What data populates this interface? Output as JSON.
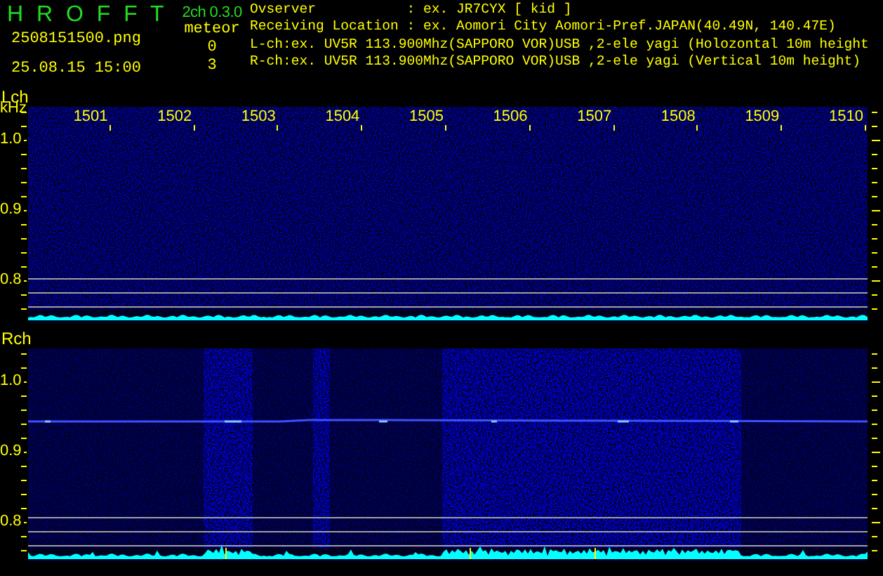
{
  "header": {
    "app_name": "H R O F F T",
    "version": "2ch 0.3.0",
    "filename": "2508151500.png",
    "timestamp": "25.08.15 15:00",
    "detection_label": "meteor",
    "counts": [
      "0",
      "3"
    ],
    "info_lines": [
      "Ovserver           : ex. JR7CYX [ kid ]",
      "Receiving Location : ex. Aomori City Aomori-Pref.JAPAN(40.49N, 140.47E)",
      "L-ch:ex. UV5R 113.900Mhz(SAPPORO VOR)USB ,2-ele yagi (Holozontal 10m height",
      "R-ch:ex. UV5R 113.900Mhz(SAPPORO VOR)USB ,2-ele yagi (Vertical 10m height)"
    ]
  },
  "channels": [
    {
      "label": "Lch",
      "unit": "kHz",
      "time_ticks": [
        "1501",
        "1502",
        "1503",
        "1504",
        "1505",
        "1506",
        "1507",
        "1508",
        "1509",
        "1510"
      ],
      "freq_ticks": [
        "1.0",
        "0.9",
        "0.8"
      ]
    },
    {
      "label": "Rch",
      "freq_ticks": [
        "1.0",
        "0.9",
        "0.8"
      ]
    }
  ]
}
